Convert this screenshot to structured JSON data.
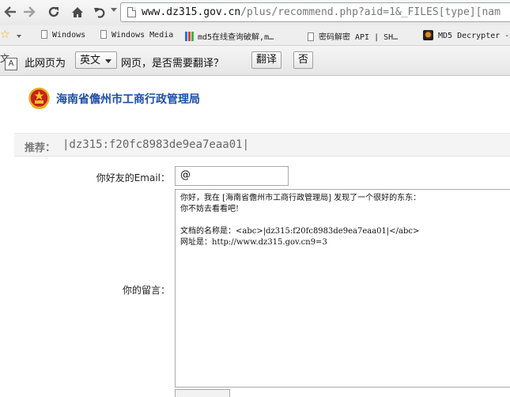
{
  "browser": {
    "url_main": "www.dz315.gov.cn",
    "url_rest": "/plus/recommend.php?aid=1&_FILES[type][nam",
    "bookmarks": [
      {
        "label": "Windows"
      },
      {
        "label": "Windows Media"
      },
      {
        "label": "md5在线查询破解,m…"
      },
      {
        "label": "密码解密 API | SH…"
      },
      {
        "label": "MD5 Decrypter -"
      }
    ]
  },
  "translate_bar": {
    "prefix": "此网页为",
    "language": "英文",
    "suffix": "网页，是否需要翻译？",
    "translate_button": "翻译",
    "no_button": "否"
  },
  "page": {
    "site_title": "海南省儋州市工商行政管理局",
    "recommend_label": "推荐：",
    "recommend_title": "|dz315:f20fc8983de9ea7eaa01|",
    "email_label": "你好友的Email：",
    "email_value": "@",
    "message_label": "你的留言：",
    "message_value": "你好，我在 [海南省儋州市工商行政管理局] 发现了一个很好的东东：\n你不妨去看看吧!\n\n文档的名称是：<abc>|dz315:f20fc8983de9ea7eaa01|</abc>\n网址是：http://www.dz315.gov.cn9=3"
  },
  "colors": {
    "site_title": "#1d4ea8",
    "star": "#e8b200"
  }
}
